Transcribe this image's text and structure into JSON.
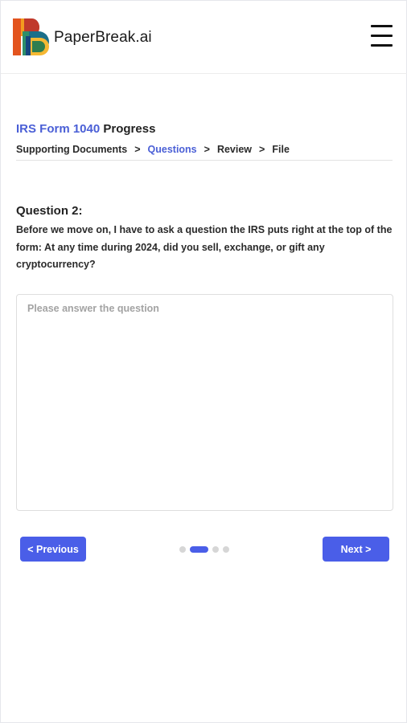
{
  "header": {
    "brand": "PaperBreak.ai",
    "menu_icon": "hamburger-menu-icon",
    "logo_colors": [
      "#f39b1f",
      "#e3541e",
      "#2e8f6a",
      "#1b4fa0",
      "#f5b833"
    ]
  },
  "progress": {
    "title_accent": "IRS Form 1040",
    "title_rest": " Progress",
    "steps": [
      {
        "label": "Supporting Documents",
        "active": false
      },
      {
        "label": "Questions",
        "active": true
      },
      {
        "label": "Review",
        "active": false
      },
      {
        "label": "File",
        "active": false
      }
    ],
    "separator": ">"
  },
  "question": {
    "heading": "Question 2:",
    "text": "Before we move on, I have to ask a question the IRS puts right at the top of the form: At any time during 2024, did you sell, exchange, or gift any cryptocurrency?"
  },
  "answer": {
    "value": "",
    "placeholder": "Please answer the question"
  },
  "navigation": {
    "previous_label": "< Previous",
    "next_label": "Next >",
    "pager": {
      "total": 4,
      "current": 2
    }
  },
  "colors": {
    "accent": "#4a5ee8",
    "accent_text": "#4a5fd6"
  }
}
